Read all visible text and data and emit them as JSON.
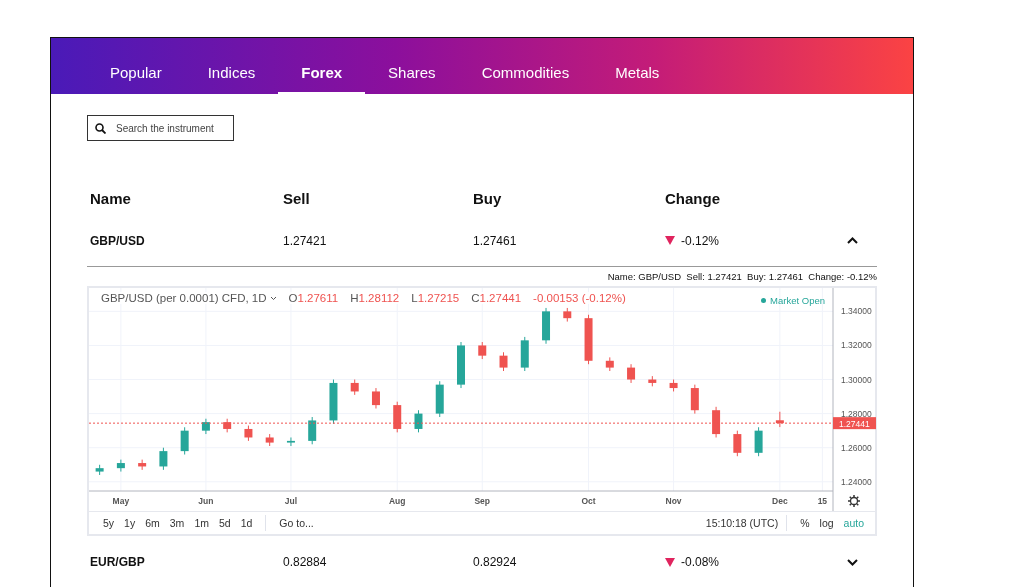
{
  "tabs": [
    {
      "label": "Popular",
      "selected": false
    },
    {
      "label": "Indices",
      "selected": false
    },
    {
      "label": "Forex",
      "selected": true
    },
    {
      "label": "Shares",
      "selected": false
    },
    {
      "label": "Commodities",
      "selected": false
    },
    {
      "label": "Metals",
      "selected": false
    }
  ],
  "search": {
    "placeholder": "Search the instrument"
  },
  "table": {
    "columns": [
      "Name",
      "Sell",
      "Buy",
      "Change"
    ],
    "rows": [
      {
        "name": "GBP/USD",
        "sell": "1.27421",
        "buy": "1.27461",
        "change": "-0.12%",
        "down": true,
        "expanded": true,
        "summary": "Name: GBP/USD  Sell: 1.27421  Buy: 1.27461  Change: -0.12%",
        "chart": {
          "symbol": "GBP/USD (per 0.0001) CFD, 1D",
          "ohlc": [
            {
              "letter": "O",
              "value": "1.27611"
            },
            {
              "letter": "H",
              "value": "1.28112"
            },
            {
              "letter": "L",
              "value": "1.27215"
            },
            {
              "letter": "C",
              "value": "1.27441"
            }
          ],
          "change": "-0.00153 (-0.12%)",
          "status": "Market Open",
          "last_price": "1.27441",
          "ranges": [
            {
              "label": "5y"
            },
            {
              "label": "1y"
            },
            {
              "label": "6m"
            },
            {
              "label": "3m"
            },
            {
              "label": "1m"
            },
            {
              "label": "5d"
            },
            {
              "label": "1d"
            }
          ],
          "goto": "Go to...",
          "time": "15:10:18 (UTC)",
          "scales": [
            {
              "label": "%",
              "selected": false
            },
            {
              "label": "log",
              "selected": false
            },
            {
              "label": "auto",
              "selected": true
            }
          ],
          "chart_data": {
            "type": "candlestick",
            "categories": [
              null,
              "May",
              null,
              null,
              null,
              "Jun",
              null,
              null,
              null,
              "Jul",
              null,
              null,
              null,
              null,
              "Aug",
              null,
              null,
              null,
              "Sep",
              null,
              null,
              null,
              null,
              "Oct",
              null,
              null,
              null,
              "Nov",
              null,
              null,
              null,
              null,
              "Dec",
              null,
              "15"
            ],
            "ohlc": [
              [
                1.246,
                1.25,
                1.244,
                1.248
              ],
              [
                1.248,
                1.253,
                1.246,
                1.251
              ],
              [
                1.251,
                1.253,
                1.247,
                1.249
              ],
              [
                1.249,
                1.26,
                1.247,
                1.258
              ],
              [
                1.258,
                1.272,
                1.256,
                1.27
              ],
              [
                1.27,
                1.277,
                1.268,
                1.275
              ],
              [
                1.275,
                1.277,
                1.269,
                1.271
              ],
              [
                1.271,
                1.273,
                1.264,
                1.266
              ],
              [
                1.266,
                1.268,
                1.261,
                1.263
              ],
              [
                1.263,
                1.266,
                1.261,
                1.264
              ],
              [
                1.264,
                1.278,
                1.262,
                1.276
              ],
              [
                1.276,
                1.3,
                1.274,
                1.298
              ],
              [
                1.298,
                1.3,
                1.291,
                1.293
              ],
              [
                1.293,
                1.295,
                1.283,
                1.285
              ],
              [
                1.285,
                1.287,
                1.269,
                1.271
              ],
              [
                1.271,
                1.282,
                1.269,
                1.28
              ],
              [
                1.28,
                1.299,
                1.278,
                1.297
              ],
              [
                1.297,
                1.322,
                1.295,
                1.32
              ],
              [
                1.32,
                1.322,
                1.312,
                1.314
              ],
              [
                1.314,
                1.316,
                1.305,
                1.307
              ],
              [
                1.307,
                1.325,
                1.305,
                1.323
              ],
              [
                1.323,
                1.342,
                1.321,
                1.34
              ],
              [
                1.34,
                1.342,
                1.334,
                1.336
              ],
              [
                1.336,
                1.338,
                1.309,
                1.311
              ],
              [
                1.311,
                1.313,
                1.305,
                1.307
              ],
              [
                1.307,
                1.309,
                1.298,
                1.3
              ],
              [
                1.3,
                1.302,
                1.296,
                1.298
              ],
              [
                1.298,
                1.3,
                1.293,
                1.295
              ],
              [
                1.295,
                1.297,
                1.28,
                1.282
              ],
              [
                1.282,
                1.284,
                1.266,
                1.268
              ],
              [
                1.268,
                1.27,
                1.255,
                1.257
              ],
              [
                1.257,
                1.272,
                1.255,
                1.27
              ],
              [
                1.2761,
                1.2811,
                1.2721,
                1.2744
              ],
              null,
              null
            ],
            "ylim": [
              1.2346,
              1.3537
            ],
            "grid": true,
            "ref_lines": [
              {
                "axis": "y",
                "value": 1.27441,
                "color": "#ef5350"
              }
            ],
            "yticks": [
              {
                "value": 1.24,
                "label": "1.24000"
              },
              {
                "value": 1.26,
                "label": "1.26000"
              },
              {
                "value": 1.28,
                "label": "1.28000"
              },
              {
                "value": 1.3,
                "label": "1.30000"
              },
              {
                "value": 1.32,
                "label": "1.32000"
              },
              {
                "value": 1.34,
                "label": "1.34000"
              }
            ]
          }
        }
      },
      {
        "name": "EUR/GBP",
        "sell": "0.82884",
        "buy": "0.82924",
        "change": "-0.08%",
        "down": true,
        "expanded": false
      }
    ]
  }
}
